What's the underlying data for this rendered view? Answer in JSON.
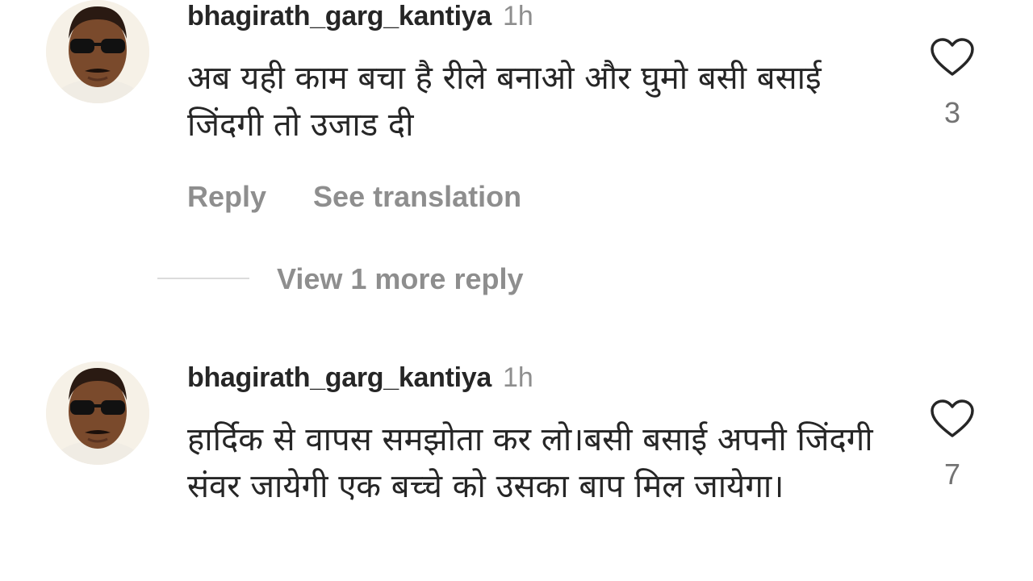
{
  "comments": [
    {
      "username": "bhagirath_garg_kantiya",
      "time": "1h",
      "text": "अब यही काम बचा है रीले बनाओ और घुमो बसी बसाई जिंदगी तो उजाड दी",
      "likes": "3",
      "reply_label": "Reply",
      "translation_label": "See translation",
      "like_icon": "heart-outline-icon",
      "avatar_icon": "user-avatar"
    },
    {
      "username": "bhagirath_garg_kantiya",
      "time": "1h",
      "text": "हार्दिक से वापस समझोता कर लो।बसी बसाई अपनी जिंदगी संवर जायेगी एक बच्चे को उसका बाप मिल जायेगा।",
      "likes": "7",
      "like_icon": "heart-outline-icon",
      "avatar_icon": "user-avatar"
    }
  ],
  "more_replies": {
    "label": "View 1 more reply"
  },
  "colors": {
    "primary_text": "#262626",
    "secondary_text": "#8e8e8e",
    "divider": "#dbdbdb"
  }
}
